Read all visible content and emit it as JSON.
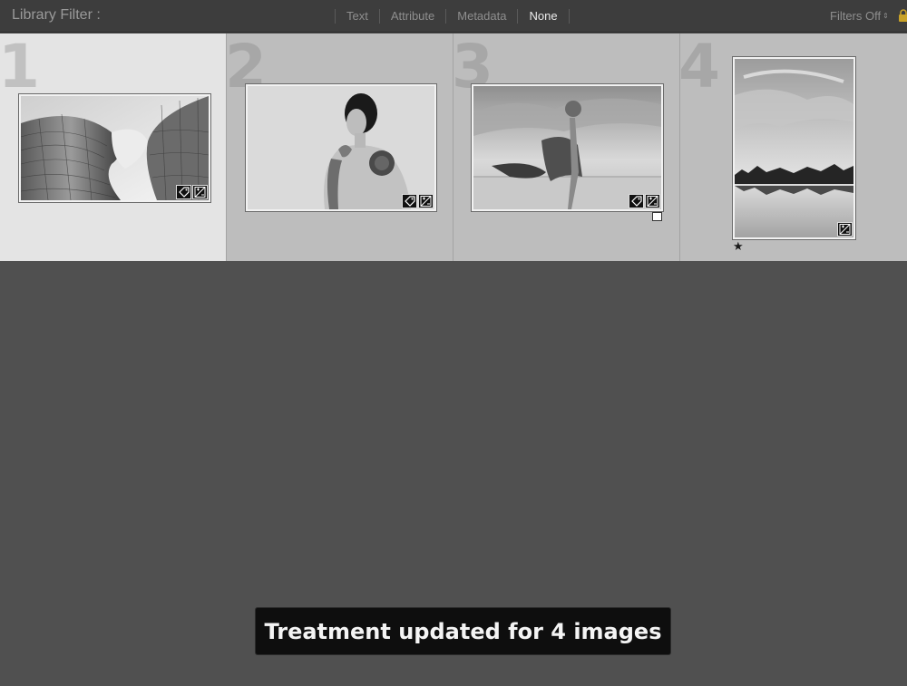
{
  "filter_bar": {
    "title": "Library Filter :",
    "tabs": [
      {
        "label": "Text",
        "active": false
      },
      {
        "label": "Attribute",
        "active": false
      },
      {
        "label": "Metadata",
        "active": false
      },
      {
        "label": "None",
        "active": true
      }
    ],
    "filters_status": "Filters Off",
    "filters_arrows": "⌃⌄",
    "lock_icon": "lock-icon"
  },
  "grid": {
    "cells": [
      {
        "number": "1",
        "selected": true,
        "image": "spiral-architecture-photo",
        "badges": [
          "tag-icon",
          "develop-adjust-icon"
        ],
        "flag": false,
        "rating": ""
      },
      {
        "number": "2",
        "selected": false,
        "image": "tattooed-woman-portrait-photo",
        "badges": [
          "tag-icon",
          "develop-adjust-icon"
        ],
        "flag": false,
        "rating": ""
      },
      {
        "number": "3",
        "selected": false,
        "image": "beach-dancer-photo",
        "badges": [
          "tag-icon",
          "develop-adjust-icon"
        ],
        "flag": true,
        "rating": ""
      },
      {
        "number": "4",
        "selected": false,
        "image": "lake-reflection-photo",
        "badges": [
          "develop-adjust-icon"
        ],
        "flag": false,
        "rating": "★"
      }
    ]
  },
  "toast": {
    "message": "Treatment updated for 4 images"
  },
  "colors": {
    "background": "#505050",
    "filter_bar": "#3d3d3d",
    "cell": "#bdbdbd",
    "cell_selected": "#e4e4e4",
    "toast": "#0e0e0e"
  }
}
